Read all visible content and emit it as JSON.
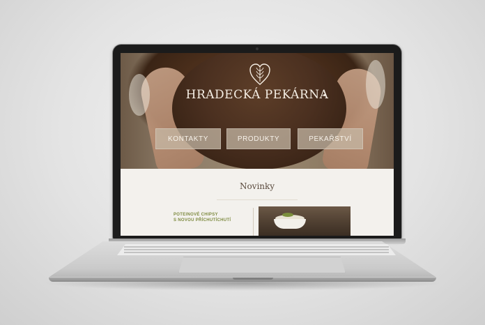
{
  "site": {
    "logo_text": "HRADECKÁ  PEKÁRNA",
    "nav": [
      {
        "label": "KONTAKTY"
      },
      {
        "label": "PRODUKTY"
      },
      {
        "label": "PEKAŘSTVÍ"
      }
    ],
    "news": {
      "heading": "Novinky",
      "item_text": "POTEINOVÉ CHIPSY\nS NOVOU PŘÍCHUTÍCHUTÍ"
    }
  },
  "icons": {
    "logo": "wheat-heart-icon"
  },
  "colors": {
    "accent_green": "#7d8a3f",
    "hero_text": "#f5eee4",
    "nav_button": "#c6b8a6"
  }
}
